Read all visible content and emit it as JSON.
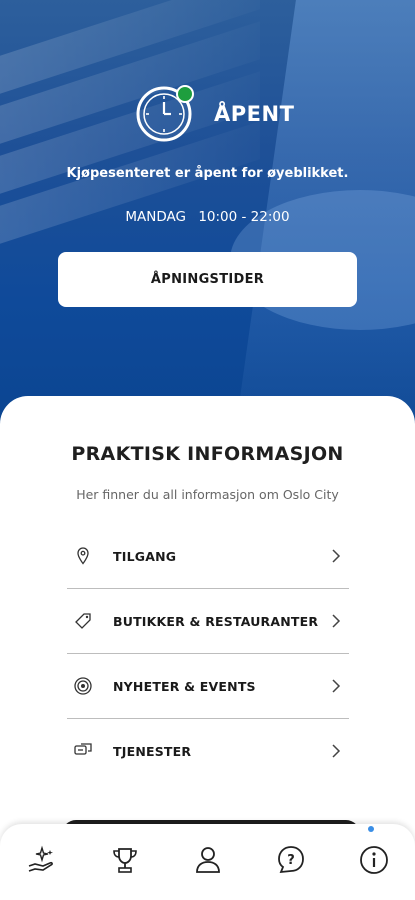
{
  "hero": {
    "status_title": "ÅPENT",
    "status_subtitle": "Kjøpesenteret er åpent for øyeblikket.",
    "today_day": "MANDAG",
    "today_hours": "10:00 - 22:00",
    "hours_button_label": "ÅPNINGSTIDER",
    "status_color": "#1e9e3e"
  },
  "info": {
    "title": "PRAKTISK INFORMASJON",
    "subtitle": "Her finner du all informasjon om Oslo City",
    "items": [
      {
        "label": "TILGANG",
        "icon": "location-pin-icon"
      },
      {
        "label": "BUTIKKER & RESTAURANTER",
        "icon": "tag-icon"
      },
      {
        "label": "NYHETER & EVENTS",
        "icon": "target-icon"
      },
      {
        "label": "TJENESTER",
        "icon": "chat-icon"
      }
    ]
  },
  "tabbar": {
    "tabs": [
      {
        "icon": "hand-stars-icon"
      },
      {
        "icon": "trophy-icon"
      },
      {
        "icon": "profile-icon"
      },
      {
        "icon": "help-icon"
      },
      {
        "icon": "info-icon",
        "active": true
      }
    ],
    "active_indicator_color": "#3a8ee6"
  }
}
